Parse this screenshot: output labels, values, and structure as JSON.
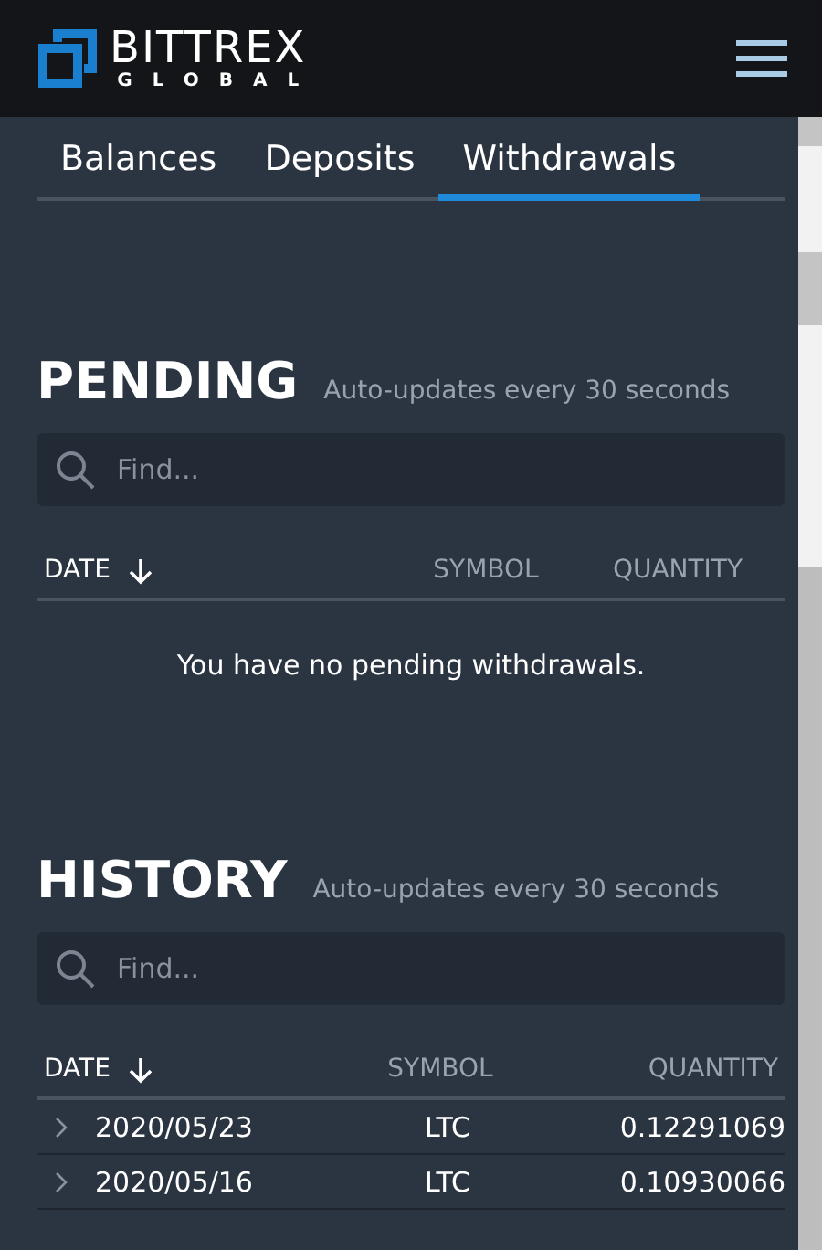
{
  "header": {
    "logo_title": "BITTREX",
    "logo_subtitle": "GLOBAL"
  },
  "tabs": [
    {
      "label": "Balances",
      "selected": false
    },
    {
      "label": "Deposits",
      "selected": false
    },
    {
      "label": "Withdrawals",
      "selected": true
    }
  ],
  "sections": [
    {
      "kind": "pending",
      "title": "PENDING",
      "subtitle": "Auto-updates every 30 seconds",
      "search": {
        "placeholder": "Find..."
      },
      "columns": [
        {
          "label": "DATE",
          "sorted": true
        },
        {
          "label": "SYMBOL",
          "sorted": false
        },
        {
          "label": "QUANTITY",
          "sorted": false
        }
      ],
      "empty_message": "You have no pending withdrawals."
    },
    {
      "kind": "history",
      "title": "HISTORY",
      "subtitle": "Auto-updates every 30 seconds",
      "search": {
        "placeholder": "Find..."
      },
      "columns": [
        {
          "label": "DATE",
          "sorted": true
        },
        {
          "label": "SYMBOL",
          "sorted": false
        },
        {
          "label": "QUANTITY",
          "sorted": false
        }
      ],
      "rows": [
        {
          "date": "2020/05/23",
          "symbol": "LTC",
          "quantity": "0.12291069",
          "expanded": false
        },
        {
          "date": "2020/05/16",
          "symbol": "LTC",
          "quantity": "0.10930066",
          "expanded": false
        }
      ]
    }
  ]
}
